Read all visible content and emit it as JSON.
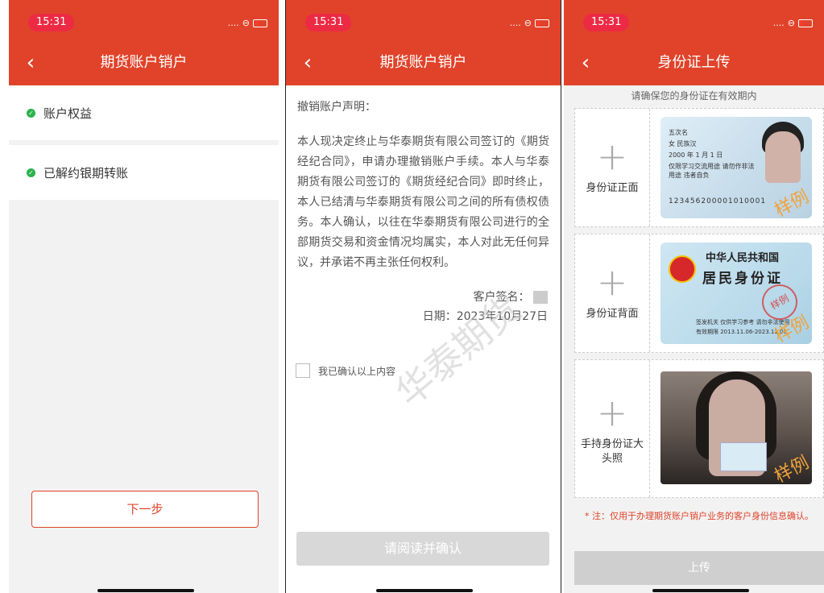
{
  "screens": {
    "cancel_list": {
      "status_time": "15:31",
      "nav_title": "期货账户销户",
      "items": [
        {
          "label": "账户权益"
        },
        {
          "label": "已解约银期转账"
        }
      ],
      "next_button": "下一步"
    },
    "statement": {
      "status_time": "15:31",
      "nav_title": "期货账户销户",
      "heading": "撤销账户声明：",
      "paragraph": "本人现决定终止与华泰期货有限公司签订的《期货经纪合同》，申请办理撤销账户手续。本人与华泰期货有限公司签订的《期货经纪合同》即时终止，本人已结清与华泰期货有限公司之间的所有债权债务。本人确认，以往在华泰期货有限公司进行的全部期货交易和资金情况均属实，本人对此无任何异议，并承诺不再主张任何权利。",
      "signature_label": "客户签名：",
      "date_label": "日期：",
      "date_value": "2023年10月27日",
      "confirm_checkbox_label": "我已确认以上内容",
      "read_confirm_button": "请阅读并确认",
      "watermark": "华泰期货"
    },
    "id_upload": {
      "status_time": "15:31",
      "nav_title": "身份证上传",
      "hint": "请确保您的身份证在有效期内",
      "cards": [
        {
          "label": "身份证正面"
        },
        {
          "label": "身份证背面"
        },
        {
          "label": "手持身份证大头照"
        }
      ],
      "sample_stamp": "样例",
      "front_sample": {
        "name_line": "五次名",
        "gender_line": "女  民族汉",
        "birth_line": "2000 年 1 月 1 日",
        "address_line": "仅限学习交流用途 请勿作非法用途 违者自负",
        "id_number": "123456200001010001"
      },
      "back_sample": {
        "country": "中华人民共和国",
        "card_title": "居民身份证",
        "issuer_line": "签发机关  仅供学习参考 请勿非法使用",
        "validity_line": "有效期限  2013.11.06-2023.11.06"
      },
      "note": "* 注：仅用于办理期货账户销户业务的客户身份信息确认。",
      "upload_button": "上传"
    }
  }
}
